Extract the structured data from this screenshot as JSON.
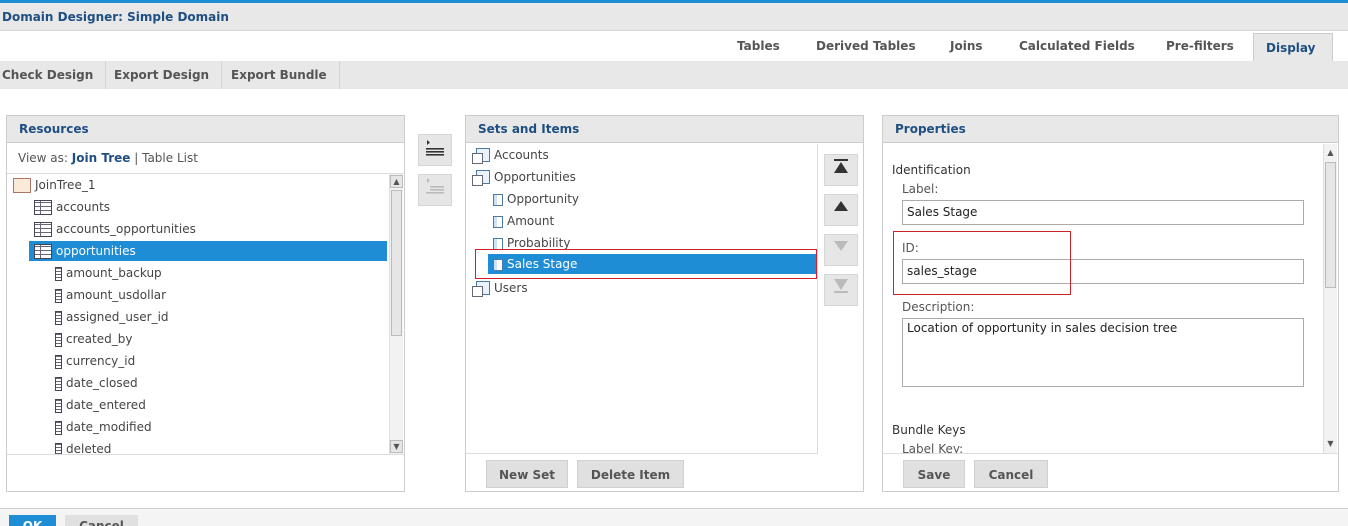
{
  "window": {
    "title": "Domain Designer: Simple Domain"
  },
  "tabs": [
    {
      "label": "Tables"
    },
    {
      "label": "Derived Tables"
    },
    {
      "label": "Joins"
    },
    {
      "label": "Calculated Fields"
    },
    {
      "label": "Pre-filters"
    },
    {
      "label": "Display",
      "active": true
    }
  ],
  "toolbar": {
    "check": "Check Design",
    "export": "Export Design",
    "bundle": "Export Bundle"
  },
  "resources": {
    "title": "Resources",
    "view_as": "View as:",
    "join_tree": "Join Tree",
    "sep": "|",
    "table_list": "Table List",
    "root": "JoinTree_1",
    "tables": [
      "accounts",
      "accounts_opportunities",
      "opportunities"
    ],
    "selected_table": "opportunities",
    "columns": [
      "amount_backup",
      "amount_usdollar",
      "assigned_user_id",
      "created_by",
      "currency_id",
      "date_closed",
      "date_entered",
      "date_modified",
      "deleted"
    ]
  },
  "sets": {
    "title": "Sets and Items",
    "tree": {
      "accounts": "Accounts",
      "opportunities": "Opportunities",
      "opportunity": "Opportunity",
      "amount": "Amount",
      "probability": "Probability",
      "sales_stage": "Sales Stage",
      "users": "Users"
    },
    "new_set": "New Set",
    "delete_item": "Delete Item"
  },
  "properties": {
    "title": "Properties",
    "identification": "Identification",
    "label_label": "Label:",
    "label_value": "Sales Stage",
    "id_label": "ID:",
    "id_value": "sales_stage",
    "description_label": "Description:",
    "description_value": "Location of opportunity in sales decision tree",
    "bundle_keys": "Bundle Keys",
    "label_key": "Label Key:",
    "save": "Save",
    "cancel": "Cancel"
  },
  "footer": {
    "ok": "OK",
    "cancel": "Cancel"
  },
  "colors": {
    "accent": "#1f8dd6",
    "heading": "#1f4f82",
    "highlight": "#d0202a"
  }
}
